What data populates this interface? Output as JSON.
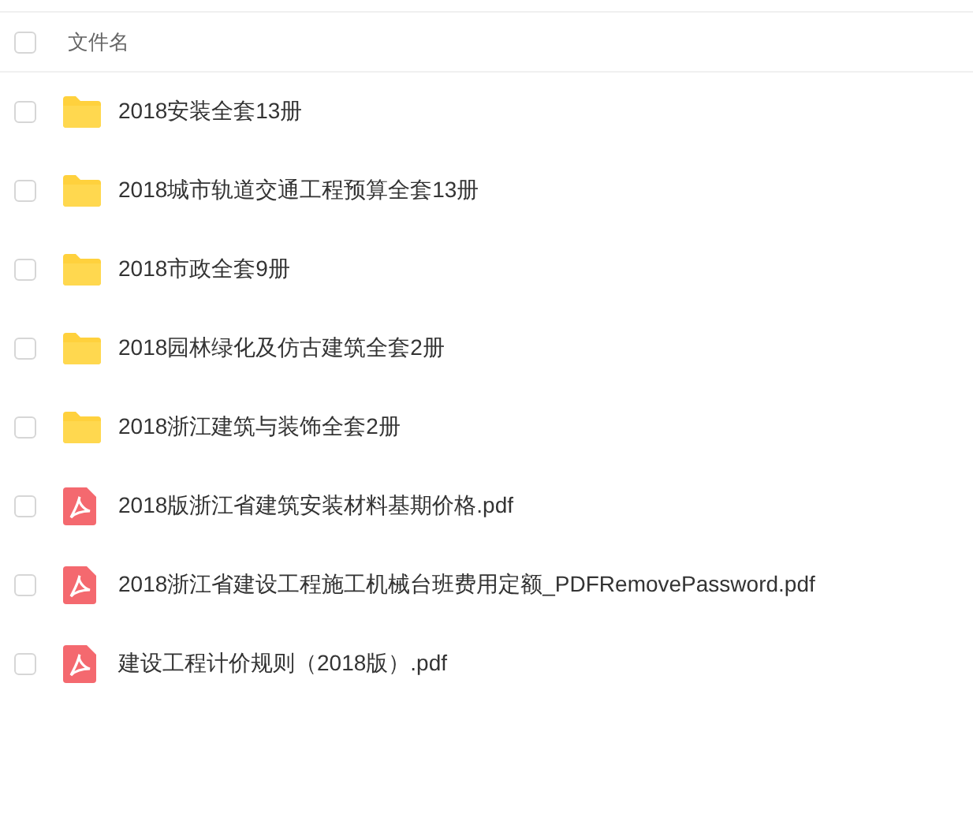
{
  "header": {
    "checked": false,
    "label": "文件名"
  },
  "files": [
    {
      "kind": "folder",
      "name": "2018安装全套13册",
      "checked": false
    },
    {
      "kind": "folder",
      "name": "2018城市轨道交通工程预算全套13册",
      "checked": false
    },
    {
      "kind": "folder",
      "name": "2018市政全套9册",
      "checked": false
    },
    {
      "kind": "folder",
      "name": "2018园林绿化及仿古建筑全套2册",
      "checked": false
    },
    {
      "kind": "folder",
      "name": "2018浙江建筑与装饰全套2册",
      "checked": false
    },
    {
      "kind": "pdf",
      "name": "2018版浙江省建筑安装材料基期价格.pdf",
      "checked": false
    },
    {
      "kind": "pdf",
      "name": "2018浙江省建设工程施工机械台班费用定额_PDFRemovePassword.pdf",
      "checked": false
    },
    {
      "kind": "pdf",
      "name": "建设工程计价规则（2018版）.pdf",
      "checked": false
    }
  ]
}
